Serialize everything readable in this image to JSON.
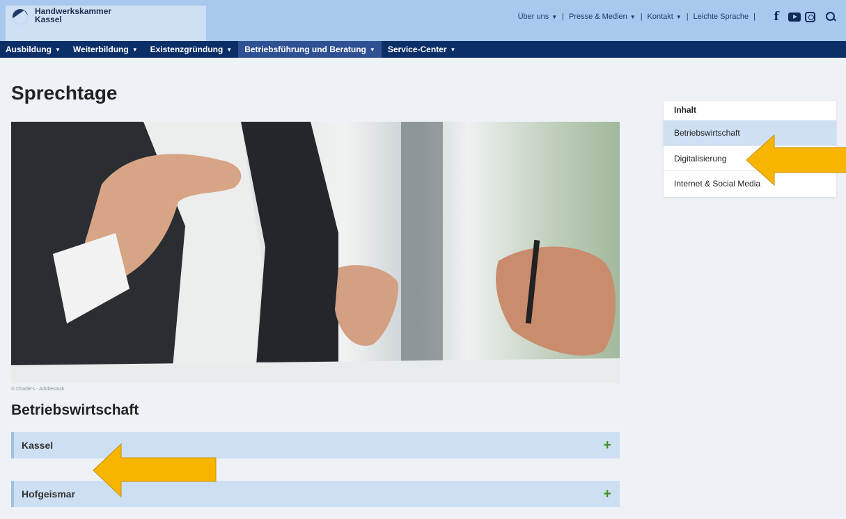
{
  "header": {
    "org_line1": "Handwerkskammer",
    "org_line2": "Kassel",
    "top_links": [
      {
        "label": "Über uns",
        "dropdown": true
      },
      {
        "label": "Presse & Medien",
        "dropdown": true
      },
      {
        "label": "Kontakt",
        "dropdown": true
      },
      {
        "label": "Leichte Sprache",
        "dropdown": false
      }
    ],
    "social_icons": [
      "facebook-icon",
      "youtube-icon",
      "instagram-icon"
    ],
    "search_icon": "search-icon",
    "colors": {
      "topbar": "#a8c8ee",
      "nav": "#0d2f68",
      "nav_active": "#2f5193"
    }
  },
  "nav": {
    "items": [
      {
        "label": "Ausbildung"
      },
      {
        "label": "Weiterbildung"
      },
      {
        "label": "Existenzgründung"
      },
      {
        "label": "Betriebsführung und Beratung",
        "active": true
      },
      {
        "label": "Service-Center"
      }
    ]
  },
  "main": {
    "title": "Sprechtage",
    "image_credit": "© Charlie's - Adobestock",
    "section_heading": "Betriebswirtschaft",
    "accordions": [
      {
        "label": "Kassel"
      },
      {
        "label": "Hofgeismar"
      }
    ]
  },
  "toc": {
    "title": "Inhalt",
    "items": [
      {
        "label": "Betriebswirtschaft",
        "active": true
      },
      {
        "label": "Digitalisierung"
      },
      {
        "label": "Internet & Social Media"
      }
    ]
  },
  "annotations": {
    "arrow_color": "#f7b500"
  }
}
